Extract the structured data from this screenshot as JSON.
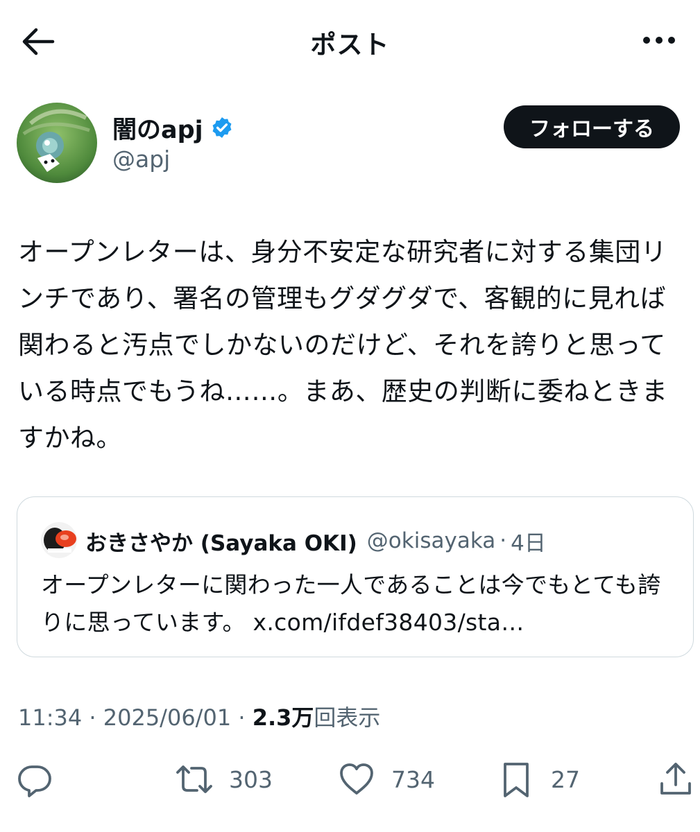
{
  "header": {
    "title": "ポスト",
    "back_icon": "arrow-left-icon",
    "more_icon": "more-horizontal-icon"
  },
  "author": {
    "name": "闇のapj",
    "handle": "@apj",
    "verified": true,
    "follow_label": "フォローする"
  },
  "post": {
    "text": "オープンレターは、身分不安定な研究者に対する集団リンチであり、署名の管理もグダグダで、客観的に見れば関わると汚点でしかないのだけど、それを誇りと思っている時点でもうね……。まあ、歴史の判断に委ねときますかね。"
  },
  "quote": {
    "name": "おきさやか (Sayaka OKI)",
    "handle": "@okisayaka",
    "separator": "·",
    "time": "4日",
    "text": "オープンレターに関わった一人であることは今でもとても誇りに思っています。",
    "link": "x.com/ifdef38403/sta…"
  },
  "meta": {
    "time": "11:34",
    "date": "2025/06/01",
    "separator": "·",
    "views": "2.3万",
    "views_label": "回表示"
  },
  "actions": {
    "retweets": "303",
    "likes": "734",
    "bookmarks": "27"
  },
  "colors": {
    "text": "#0f1419",
    "secondary": "#536471",
    "verified": "#1d9bf0",
    "border": "#cfd9de"
  }
}
